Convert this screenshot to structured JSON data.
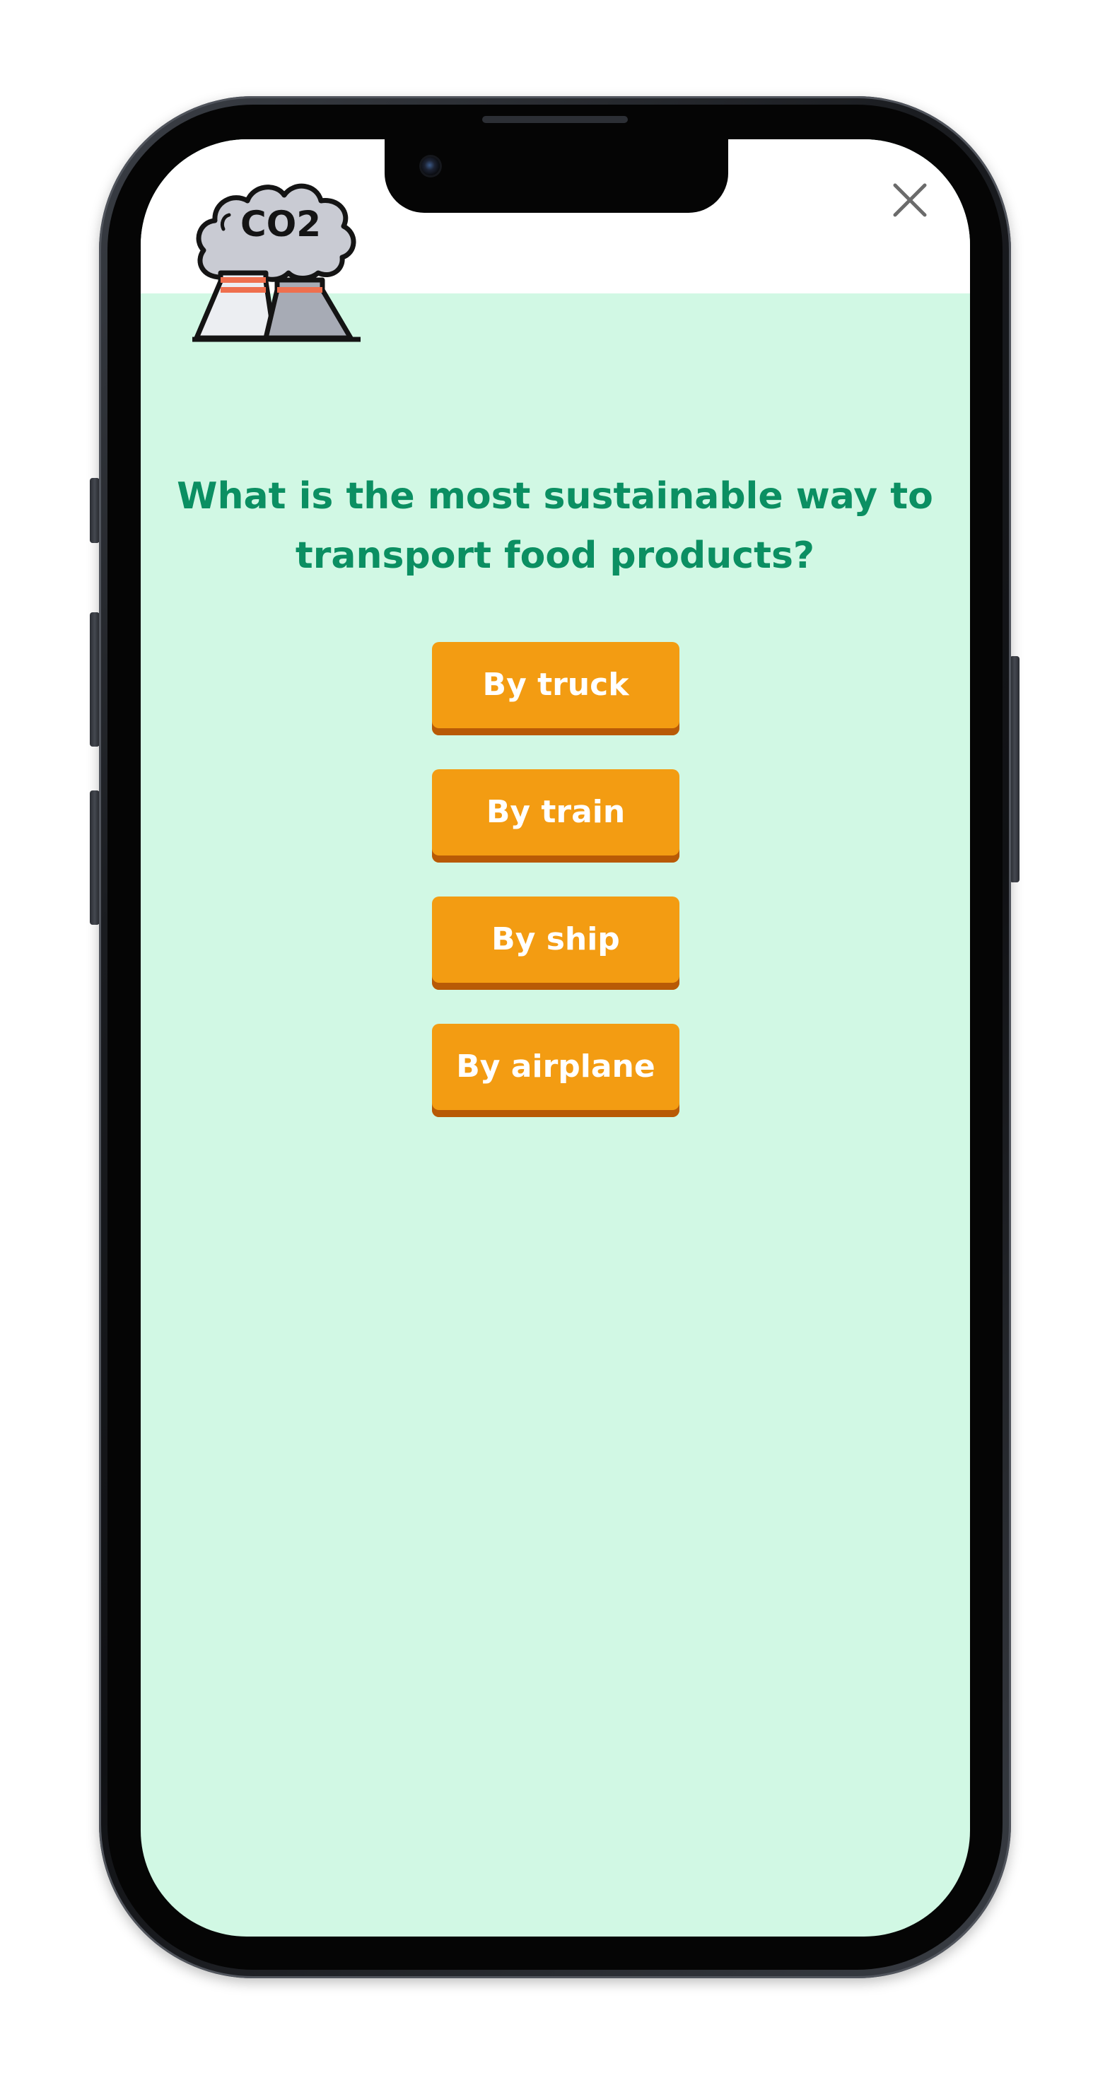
{
  "quiz": {
    "close_label": "Close",
    "question": "What is the most sustainable way to transport food products?",
    "answers": [
      {
        "label": "By truck"
      },
      {
        "label": "By train"
      },
      {
        "label": "By ship"
      },
      {
        "label": "By airplane"
      }
    ]
  },
  "logo": {
    "icon": "co2-factory-icon",
    "text": "CO2"
  },
  "colors": {
    "screen_background": "#d1f8e4",
    "header_background": "#ffffff",
    "question_text": "#0b8f62",
    "answer_button": "#f39c12",
    "answer_button_shadow": "#b85a06",
    "answer_text": "#ffffff",
    "close_icon": "#6b6b6b"
  }
}
